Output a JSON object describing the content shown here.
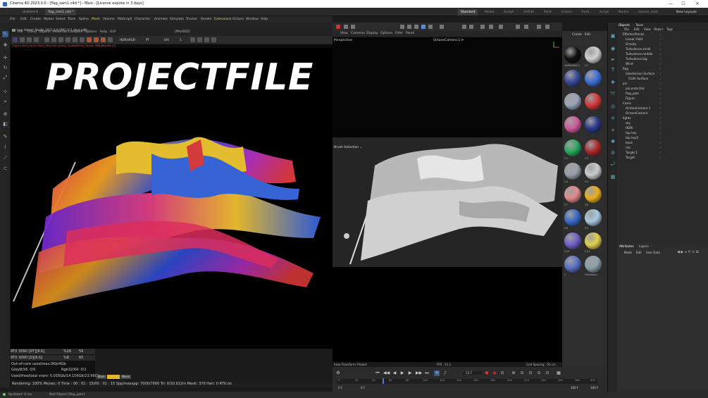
{
  "window": {
    "title": "Cinema 4D 2023.0.0 - [flag_cam1.c4d *] - Main - [License expires in 3 days]",
    "minimize": "—",
    "maximize": "☐",
    "close": "✕"
  },
  "doc_tabs": [
    "Untitled 6",
    "flag_cam1.c4d *"
  ],
  "layout_tabs": [
    "Standard",
    "Model",
    "Sculpt",
    "UVEdit",
    "Paint",
    "Groom",
    "Track",
    "Script",
    "Nodes",
    "octane_start"
  ],
  "new_layouts": "New Layouts",
  "main_menu": [
    "File",
    "Edit",
    "Create",
    "Modes",
    "Select",
    "Tools",
    "Spline",
    "Mesh",
    "Volume",
    "MoGraph",
    "Character",
    "Animate",
    "Simulate",
    "Tracker",
    "Render",
    "Extensions",
    "Octane",
    "Window",
    "Help"
  ],
  "live_viewer": {
    "title": "Live Viewer Studio 2021.1.6-[R6] (1.1 days left)",
    "menu": [
      "File",
      "Cloud",
      "Objects",
      "Materials",
      "Compare",
      "Options",
      "Help",
      "GUI"
    ],
    "paused": "[PAUSED]",
    "color_mode": "HDR/sRGB",
    "pt": "PT",
    "value1": "0/4",
    "value2": "1",
    "status": "Check [3ms], Anim [0ms], MeshGen [0ms], Update[0ms], Nodes: 568 Movable [0]",
    "overlay_text": "PROJECTFILE",
    "stats": {
      "gpu1": "RTX 3090 [DT][8.6]",
      "gpu1_pct": "%16",
      "gpu1_val": "59",
      "gpu2": "RTX 3090 [D][8.6]",
      "gpu2_pct": "%8",
      "gpu2_val": "65",
      "out_of_core": "Out-of-core used/max:0Kb/4Gb",
      "grey": "Grey8/16: 0/0",
      "rgb": "Rgb32/64: 0/1",
      "vram": "Used/free/total vram: 5.016Gb/14.156Gb/23.99Gb",
      "legend": [
        "Main",
        "",
        "Noise"
      ]
    },
    "render_status": "Rendering: 100% Ms/sec: 0    Time : 00 : 01 : 15/00 : 01 : 15    Spp/maxspp: 7000/7000    Tri: 0/10.022m    Mesh: 370    Hair: 0    RTX:on"
  },
  "viewport": {
    "menu": [
      "View",
      "Cameras",
      "Display",
      "Options",
      "Filter",
      "Panel"
    ],
    "top_label": "Perspective",
    "top_camera": "OctaneCamera.1 ⟳",
    "bottom_label": "Brush Selection ⌄",
    "view_transform": "View Transform: Project",
    "fps": "FPS : 51.2",
    "grid": "Grid Spacing : 50 cm"
  },
  "timeline": {
    "frame_field": "53 F",
    "ruler": [
      "0",
      "20",
      "40",
      "60",
      "80",
      "100",
      "120",
      "140",
      "160",
      "180",
      "200",
      "220",
      "240",
      "260",
      "280",
      "300"
    ],
    "start": "0 F",
    "start2": "0 F",
    "end": "300 F",
    "end2": "300 F"
  },
  "materials": {
    "menu": [
      "Create",
      "Edit"
    ],
    "items": [
      {
        "label": "OctMixMat2.1",
        "color": "#111111"
      },
      {
        "label": "2.2",
        "color": "#cfcfcf"
      },
      {
        "label": "",
        "color": "#3a4a9a"
      },
      {
        "label": "",
        "color": "#3f6fd8"
      },
      {
        "label": "",
        "color": "#9aa4b8"
      },
      {
        "label": "",
        "color": "#d03a3a"
      },
      {
        "label": "",
        "color": "#d05a9a"
      },
      {
        "label": "",
        "color": "#2a3a8a"
      },
      {
        "label": "2.1",
        "color": "#2aa860"
      },
      {
        "label": "2.5",
        "color": "#a82a2a"
      },
      {
        "label": "2.4",
        "color": "#9aa0a8"
      },
      {
        "label": "2.3",
        "color": "#c8ccd0"
      },
      {
        "label": "2.7",
        "color": "#e08a8a"
      },
      {
        "label": "2.8",
        "color": "#e8b020"
      },
      {
        "label": "2.9",
        "color": "#3a6ac8"
      },
      {
        "label": "2.1",
        "color": "#a8c8e0"
      },
      {
        "label": "2.10",
        "color": "#7060c8"
      },
      {
        "label": "2.11",
        "color": "#e0d050"
      },
      {
        "label": "2",
        "color": "#5a70c8"
      },
      {
        "label": "OctGlossy1",
        "color": "#8aa0a8"
      }
    ]
  },
  "objects": {
    "tabs": [
      "Objects",
      "Takes"
    ],
    "menu": [
      "File",
      "Edit",
      "View",
      "Object",
      "Tags"
    ],
    "items": [
      {
        "name": "Effector/forces",
        "indent": 0,
        "color": "#d0d0d0"
      },
      {
        "name": "Linear Field",
        "indent": 1,
        "color": "#d0d0d0"
      },
      {
        "name": "Gravity",
        "indent": 1,
        "color": "#d0d0d0"
      },
      {
        "name": "Turbulence.small",
        "indent": 1,
        "color": "#d0d0d0"
      },
      {
        "name": "Turbulence.middle",
        "indent": 1,
        "color": "#d0d0d0"
      },
      {
        "name": "Turbulence.big",
        "indent": 1,
        "color": "#d0d0d0"
      },
      {
        "name": "Wind",
        "indent": 1,
        "color": "#d0d0d0"
      },
      {
        "name": "flag",
        "indent": 0,
        "color": "#d0d0d0"
      },
      {
        "name": "Subdivision Surface",
        "indent": 1,
        "color": "#d0d0d0"
      },
      {
        "name": "Cloth Surface",
        "indent": 2,
        "color": "#d0d0d0"
      },
      {
        "name": "pin",
        "indent": 0,
        "color": "#d0d0d0"
      },
      {
        "name": "pin.ends.this",
        "indent": 1,
        "color": "#d0d0d0"
      },
      {
        "name": "flag_pole",
        "indent": 1,
        "color": "#d0d0d0"
      },
      {
        "name": "Figure",
        "indent": 1,
        "color": "#d0d0d0"
      },
      {
        "name": "Cams",
        "indent": 0,
        "color": "#d0d0d0"
      },
      {
        "name": "OctaneCamera.1",
        "indent": 1,
        "color": "#d0d0d0"
      },
      {
        "name": "OctaneCamera",
        "indent": 1,
        "color": "#d0d0d0"
      },
      {
        "name": "lights",
        "indent": 0,
        "color": "#d0d0d0"
      },
      {
        "name": "sky",
        "indent": 1,
        "color": "#d0d0d0"
      },
      {
        "name": "HDRi",
        "indent": 1,
        "color": "#d0d0d0"
      },
      {
        "name": "top key",
        "indent": 1,
        "color": "#d0d0d0"
      },
      {
        "name": "top key2",
        "indent": 1,
        "color": "#d0d0d0"
      },
      {
        "name": "back",
        "indent": 1,
        "color": "#d0d0d0"
      },
      {
        "name": "rim",
        "indent": 1,
        "color": "#d0d0d0"
      },
      {
        "name": "Target.1",
        "indent": 1,
        "color": "#d0d0d0"
      },
      {
        "name": "Target",
        "indent": 1,
        "color": "#d0d0d0"
      }
    ]
  },
  "attributes": {
    "tabs": [
      "Attributes",
      "Layers"
    ],
    "menu": [
      "Mode",
      "Edit",
      "User Data"
    ]
  },
  "status_bar": {
    "updated": "Updated: 0 ms.",
    "object": "Null Object [flag_pole]"
  }
}
